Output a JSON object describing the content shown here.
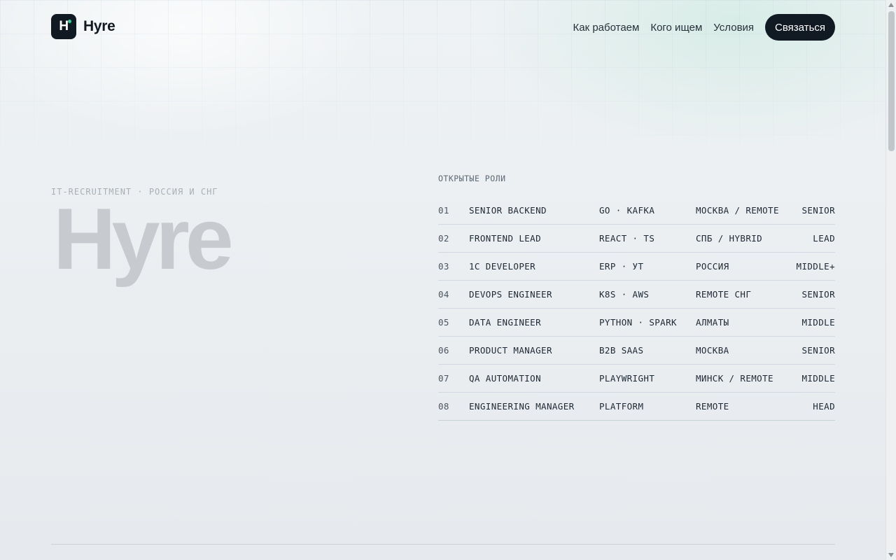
{
  "header": {
    "logo_letter": "H",
    "brand": "Hyre",
    "nav": [
      {
        "label": "Как работаем"
      },
      {
        "label": "Кого ищем"
      },
      {
        "label": "Условия"
      }
    ],
    "cta_label": "Связаться"
  },
  "hero": {
    "eyebrow": "IT-RECRUITMENT · РОССИЯ И СНГ",
    "wordmark": "Hyre"
  },
  "roles": {
    "title": "ОТКРЫТЫЕ РОЛИ",
    "items": [
      {
        "num": "01",
        "title": "SENIOR BACKEND",
        "stack": "GO · KAFKA",
        "location": "МОСКВА / REMOTE",
        "level": "SENIOR"
      },
      {
        "num": "02",
        "title": "FRONTEND LEAD",
        "stack": "REACT · TS",
        "location": "СПБ / HYBRID",
        "level": "LEAD"
      },
      {
        "num": "03",
        "title": "1C DEVELOPER",
        "stack": "ERP · УТ",
        "location": "РОССИЯ",
        "level": "MIDDLE+"
      },
      {
        "num": "04",
        "title": "DEVOPS ENGINEER",
        "stack": "K8S · AWS",
        "location": "REMOTE СНГ",
        "level": "SENIOR"
      },
      {
        "num": "05",
        "title": "DATA ENGINEER",
        "stack": "PYTHON · SPARK",
        "location": "АЛМАТЫ",
        "level": "MIDDLE"
      },
      {
        "num": "06",
        "title": "PRODUCT MANAGER",
        "stack": "B2B SAAS",
        "location": "МОСКВА",
        "level": "SENIOR"
      },
      {
        "num": "07",
        "title": "QA AUTOMATION",
        "stack": "PLAYWRIGHT",
        "location": "МИНСК / REMOTE",
        "level": "MIDDLE"
      },
      {
        "num": "08",
        "title": "ENGINEERING MANAGER",
        "stack": "PLATFORM",
        "location": "REMOTE",
        "level": "HEAD"
      }
    ]
  },
  "colors": {
    "brand_dark": "#111a22",
    "accent": "#2ed39a"
  }
}
